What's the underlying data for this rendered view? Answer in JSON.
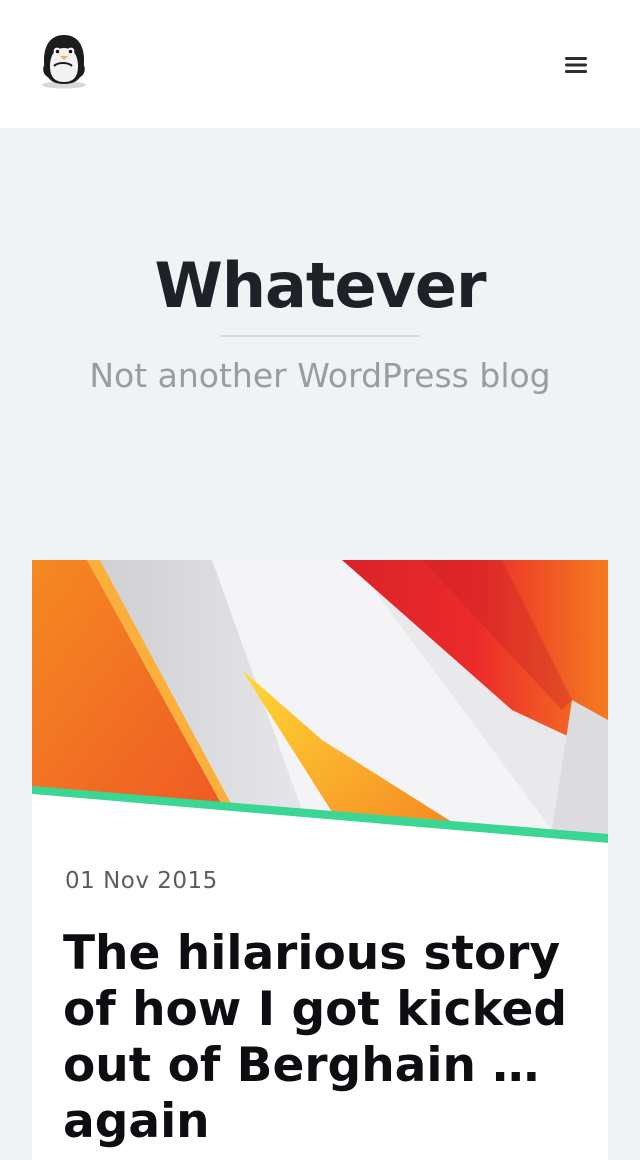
{
  "header": {
    "logo_icon": "penguin-logo-icon",
    "menu_icon": "hamburger-menu-icon"
  },
  "hero": {
    "title": "Whatever",
    "tagline": "Not another WordPress blog"
  },
  "post": {
    "date": "01 Nov 2015",
    "title": "The hilarious story of how I got kicked out of Berghain … again",
    "accent_color": "#3ad694"
  },
  "colors": {
    "background": "#f1f2f4",
    "title": "#1f2128",
    "tagline": "#9a9ca3",
    "accent": "#3ad694"
  }
}
